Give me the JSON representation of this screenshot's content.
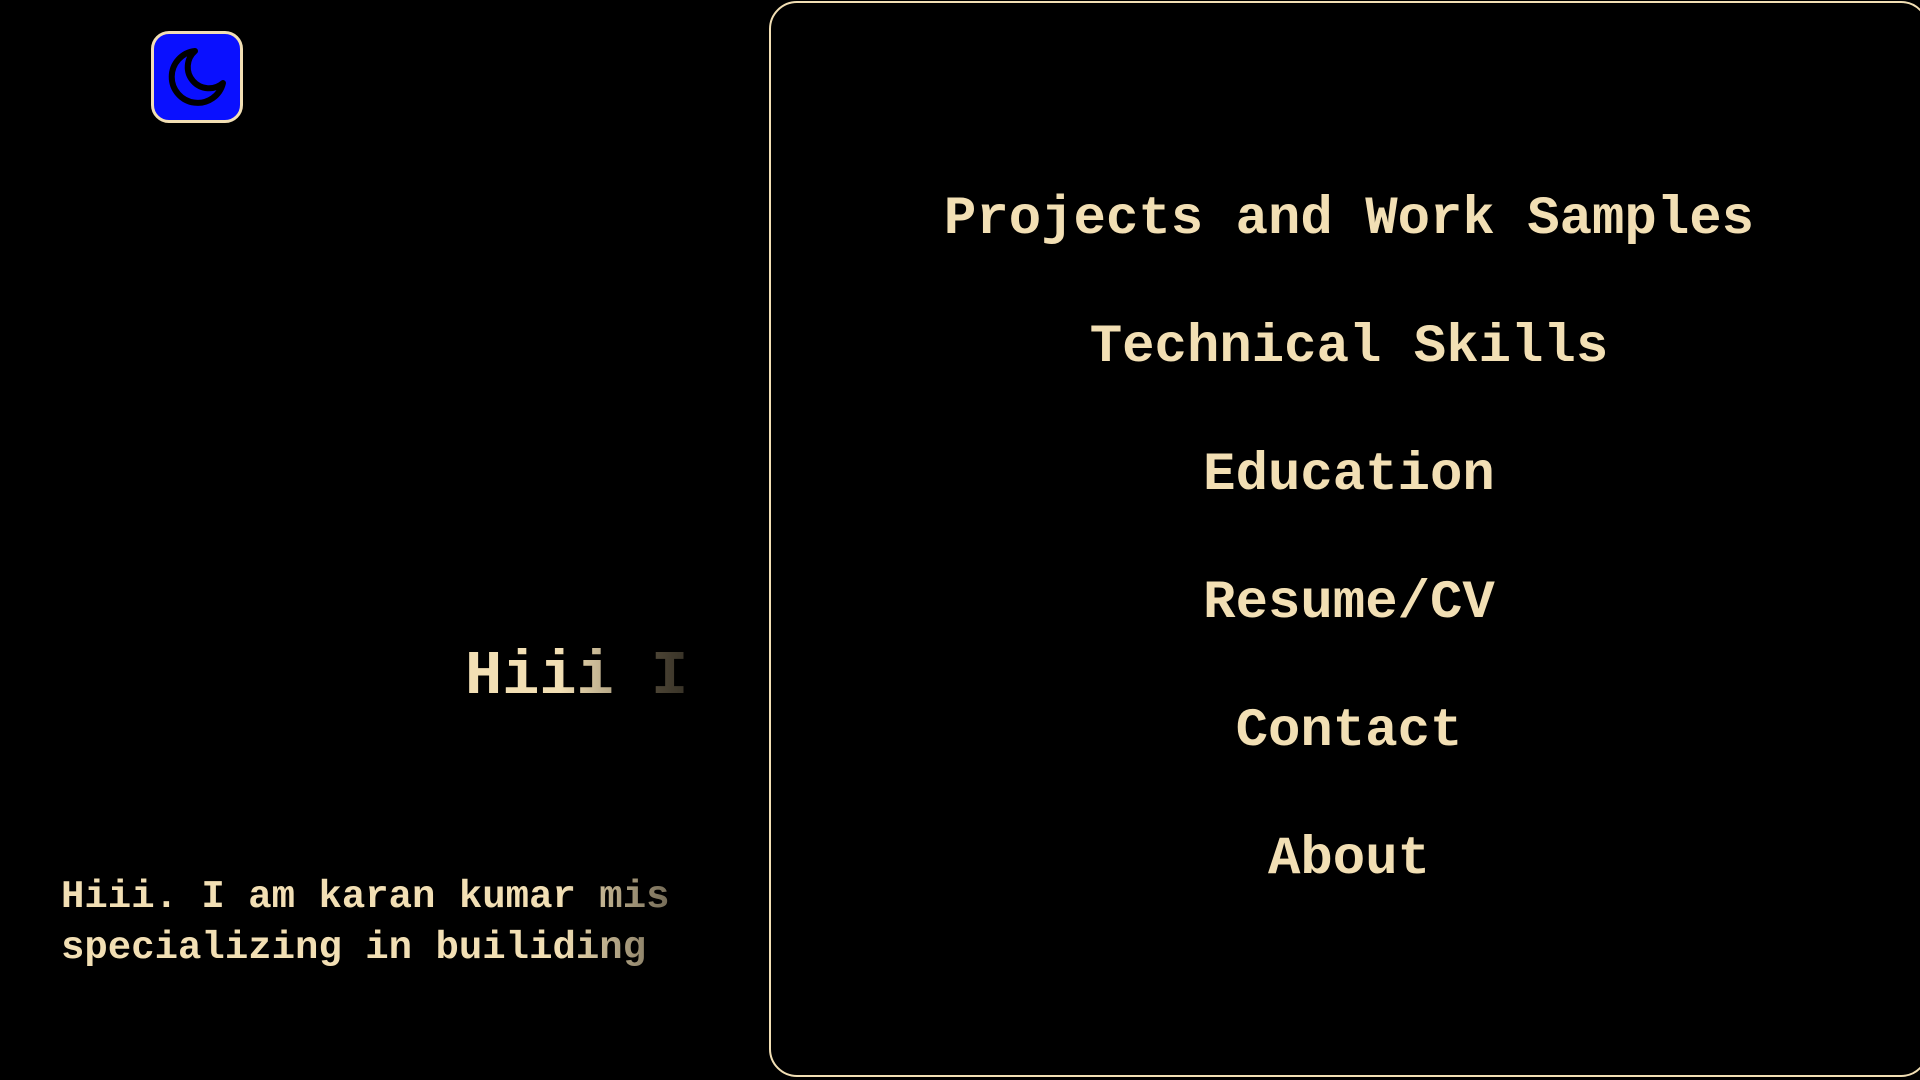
{
  "theme": {
    "background": "#000000",
    "text_color": "#f2dfb4",
    "toggle_color": "#0a10ff"
  },
  "toggle": {
    "icon": "moon-icon"
  },
  "hero": {
    "heading_visible": "Hiii ",
    "heading_faded": "I",
    "intro_line1": "Hiii. I am karan kumar mis",
    "intro_line2": "specializing in builiding"
  },
  "menu": {
    "items": [
      {
        "label": "Projects and Work Samples"
      },
      {
        "label": "Technical Skills"
      },
      {
        "label": "Education"
      },
      {
        "label": "Resume/CV"
      },
      {
        "label": "Contact"
      },
      {
        "label": "About"
      }
    ]
  }
}
